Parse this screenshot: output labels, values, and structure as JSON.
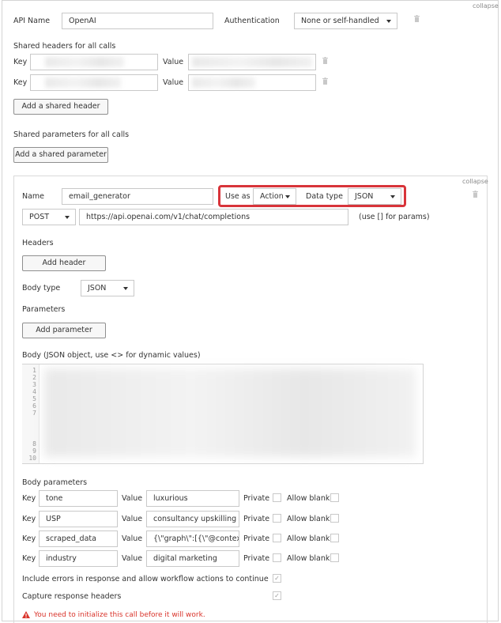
{
  "collapse_label": "collapse",
  "api": {
    "name_label": "API Name",
    "name_value": "OpenAI",
    "auth_label": "Authentication",
    "auth_value": "None or self-handled"
  },
  "shared_headers": {
    "section_label": "Shared headers for all calls",
    "key_label": "Key",
    "value_label": "Value",
    "add_button": "Add a shared header"
  },
  "shared_params": {
    "section_label": "Shared parameters for all calls",
    "add_button": "Add a shared parameter"
  },
  "call": {
    "collapse_label": "collapse",
    "name_label": "Name",
    "name_value": "email_generator",
    "use_as_label": "Use as",
    "use_as_value": "Action",
    "data_type_label": "Data type",
    "data_type_value": "JSON",
    "method": "POST",
    "url": "https://api.openai.com/v1/chat/completions",
    "url_hint": "(use [] for params)",
    "headers_label": "Headers",
    "add_header_button": "Add header",
    "body_type_label": "Body type",
    "body_type_value": "JSON",
    "parameters_label": "Parameters",
    "add_parameter_button": "Add parameter",
    "body_label": "Body (JSON object, use <> for dynamic values)",
    "line_numbers": [
      "1",
      "2",
      "3",
      "4",
      "5",
      "6",
      "7",
      "8",
      "9",
      "10"
    ],
    "body_params_label": "Body parameters",
    "key_label": "Key",
    "value_label": "Value",
    "private_label": "Private",
    "allow_blank_label": "Allow blank",
    "body_params": [
      {
        "key": "tone",
        "value": "luxurious"
      },
      {
        "key": "USP",
        "value": "consultancy upskilling ma"
      },
      {
        "key": "scraped_data",
        "value": "{\\\"graph\\\":[{\\\"@context\\\":\\"
      },
      {
        "key": "industry",
        "value": "digital marketing"
      }
    ],
    "include_errors_label": "Include errors in response and allow workflow actions to continue",
    "capture_headers_label": "Capture response headers",
    "checkmark": "✓",
    "warning_icon": "warning-icon",
    "error_message": "You need to initialize this call before it will work."
  },
  "colors": {
    "highlight": "#d8343a",
    "error": "#d9342b"
  }
}
